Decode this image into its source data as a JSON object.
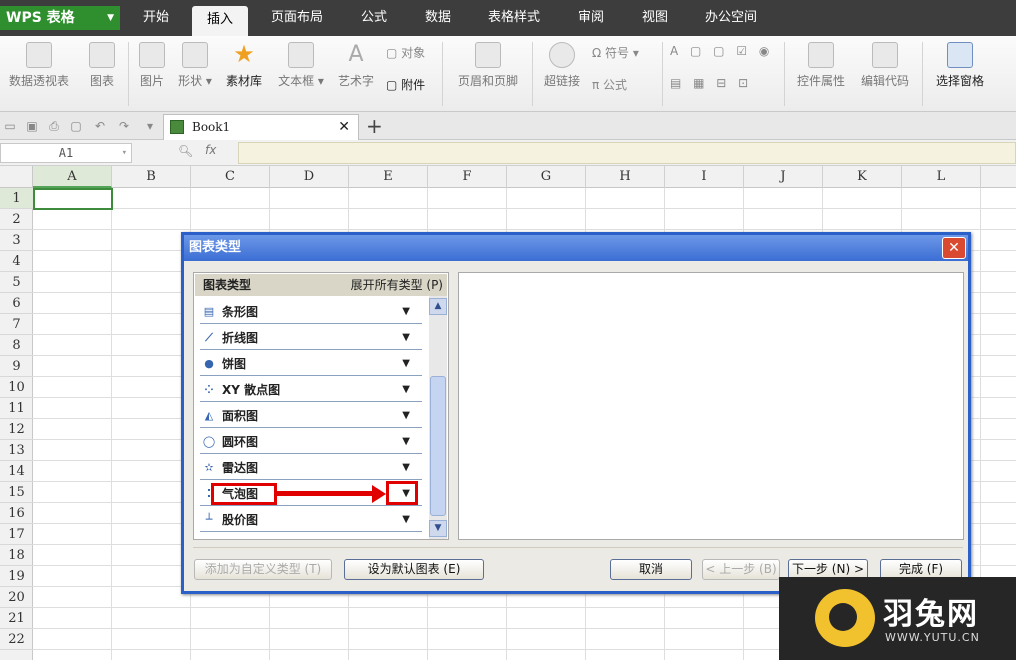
{
  "app": {
    "name": "WPS 表格"
  },
  "menu": {
    "items": [
      "开始",
      "插入",
      "页面布局",
      "公式",
      "数据",
      "表格样式",
      "审阅",
      "视图",
      "办公空间"
    ],
    "active": "插入"
  },
  "ribbon": {
    "pivot": "数据透视表",
    "chart": "图表",
    "picture": "图片",
    "shape": "形状",
    "material": "素材库",
    "textbox": "文本框",
    "wordart": "艺术字",
    "object": "对象",
    "attachment": "附件",
    "header_footer": "页眉和页脚",
    "hyperlink": "超链接",
    "symbol": "符号",
    "formula": "公式",
    "control_props": "控件属性",
    "edit_code": "编辑代码",
    "select_pane": "选择窗格"
  },
  "workbook": {
    "tab": "Book1"
  },
  "formula_bar": {
    "cell_ref": "A1",
    "fx": "fx",
    "value": ""
  },
  "sheet": {
    "columns": [
      "A",
      "B",
      "C",
      "D",
      "E",
      "F",
      "G",
      "H",
      "I",
      "J",
      "K",
      "L"
    ],
    "rows": [
      "1",
      "2",
      "3",
      "4",
      "5",
      "6",
      "7",
      "8",
      "9",
      "10",
      "11",
      "12",
      "13",
      "14",
      "15",
      "16",
      "17",
      "18",
      "19",
      "20",
      "21",
      "22"
    ],
    "selected_cell": "A1"
  },
  "dialog": {
    "title": "图表类型",
    "list_header": "图表类型",
    "expand_all": "展开所有类型 (P)",
    "chart_types": [
      {
        "label": "条形图",
        "icon": "bar-chart-icon"
      },
      {
        "label": "折线图",
        "icon": "line-chart-icon"
      },
      {
        "label": "饼图",
        "icon": "pie-chart-icon"
      },
      {
        "label": "XY 散点图",
        "icon": "scatter-chart-icon"
      },
      {
        "label": "面积图",
        "icon": "area-chart-icon"
      },
      {
        "label": "圆环图",
        "icon": "doughnut-chart-icon"
      },
      {
        "label": "雷达图",
        "icon": "radar-chart-icon"
      },
      {
        "label": "气泡图",
        "icon": "bubble-chart-icon"
      },
      {
        "label": "股价图",
        "icon": "stock-chart-icon"
      }
    ],
    "buttons": {
      "add_custom": "添加为自定义类型 (T)",
      "set_default": "设为默认图表 (E)",
      "cancel": "取消",
      "prev": "< 上一步 (B)",
      "next": "下一步 (N) >",
      "finish": "完成 (F)"
    }
  },
  "watermark": {
    "name": "羽兔网",
    "url": "WWW.YUTU.CN"
  }
}
